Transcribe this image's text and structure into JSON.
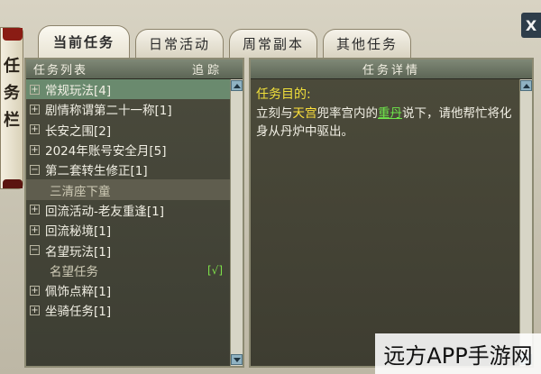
{
  "scroll_decoration": {
    "chars": [
      "任",
      "务",
      "栏"
    ]
  },
  "close_button": {
    "label": "X"
  },
  "tabs": [
    {
      "label": "当前任务",
      "active": true
    },
    {
      "label": "日常活动",
      "active": false
    },
    {
      "label": "周常副本",
      "active": false
    },
    {
      "label": "其他任务",
      "active": false
    }
  ],
  "quest_list": {
    "header": "任务列表",
    "track_label": "追踪",
    "items": [
      {
        "toggle": "⊞",
        "label": "常规玩法[4]",
        "state": "highlight"
      },
      {
        "toggle": "⊞",
        "label": "剧情称谓第二十一称[1]"
      },
      {
        "toggle": "⊞",
        "label": "长安之围[2]"
      },
      {
        "toggle": "⊞",
        "label": "2024年账号安全月[5]"
      },
      {
        "toggle": "⊟",
        "label": "第二套转生修正[1]"
      },
      {
        "toggle": "",
        "label": "三清座下童",
        "state": "selected",
        "sub": true
      },
      {
        "toggle": "⊞",
        "label": "回流活动-老友重逢[1]"
      },
      {
        "toggle": "⊞",
        "label": "回流秘境[1]"
      },
      {
        "toggle": "⊟",
        "label": "名望玩法[1]"
      },
      {
        "toggle": "",
        "label": "名望任务",
        "sub": true,
        "check": "[√]"
      },
      {
        "toggle": "⊞",
        "label": "佩饰点粹[1]"
      },
      {
        "toggle": "⊞",
        "label": "坐骑任务[1]"
      }
    ]
  },
  "quest_detail": {
    "header": "任务详情",
    "goal_label": "任务目的:",
    "text_part1": "立刻与",
    "text_hl1": "天宫",
    "text_part2": "兜率宫内的",
    "text_hl2": "重丹",
    "text_part3": "说下，请他帮忙将化身从丹炉中驱出。"
  },
  "watermark": "远方APP手游网",
  "colors": {
    "goal_label": "#f1e03a",
    "highlight_place": "#ffe23a",
    "highlight_npc": "#6ee64b",
    "check": "#7ee04a"
  }
}
